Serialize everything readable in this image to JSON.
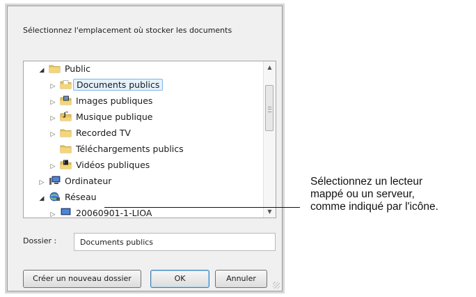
{
  "dialog": {
    "prompt": "Sélectionnez l'emplacement où stocker les documents",
    "tree": [
      {
        "label": "Public",
        "icon": "folder-icon",
        "expander": "expanded",
        "selected": false
      },
      {
        "label": "Documents publics",
        "icon": "documents-folder-icon",
        "expander": "collapsed",
        "selected": true
      },
      {
        "label": "Images publiques",
        "icon": "pictures-folder-icon",
        "expander": "collapsed",
        "selected": false
      },
      {
        "label": "Musique publique",
        "icon": "music-folder-icon",
        "expander": "collapsed",
        "selected": false
      },
      {
        "label": "Recorded TV",
        "icon": "folder-icon",
        "expander": "collapsed",
        "selected": false
      },
      {
        "label": "Téléchargements publics",
        "icon": "folder-icon",
        "expander": "none",
        "selected": false
      },
      {
        "label": "Vidéos publiques",
        "icon": "videos-folder-icon",
        "expander": "collapsed",
        "selected": false
      },
      {
        "label": "Ordinateur",
        "icon": "computer-icon",
        "expander": "collapsed",
        "selected": false
      },
      {
        "label": "Réseau",
        "icon": "network-icon",
        "expander": "expanded",
        "selected": false
      },
      {
        "label": "20060901-1-LIOA",
        "icon": "network-computer-icon",
        "expander": "collapsed",
        "selected": false
      }
    ],
    "folder_label": "Dossier :",
    "folder_value": "Documents publics",
    "buttons": {
      "new_folder": "Créer un nouveau dossier",
      "ok": "OK",
      "cancel": "Annuler"
    }
  },
  "callout": {
    "lines": [
      "Sélectionnez un lecteur",
      "mappé ou un serveur,",
      "comme indiqué par l'icône."
    ]
  },
  "colors": {
    "selection_bg": "#e5f1fb",
    "selection_border": "#7fb6e6",
    "folder_yellow": "#e8c35a"
  }
}
